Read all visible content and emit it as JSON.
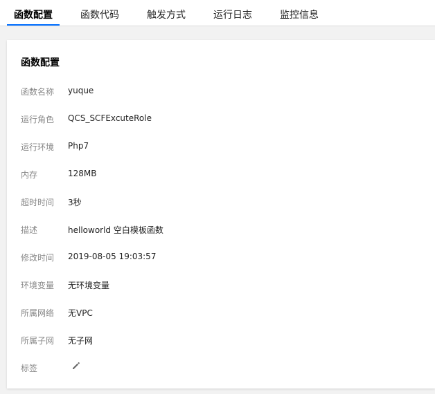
{
  "tabs": [
    {
      "label": "函数配置",
      "active": true
    },
    {
      "label": "函数代码",
      "active": false
    },
    {
      "label": "触发方式",
      "active": false
    },
    {
      "label": "运行日志",
      "active": false
    },
    {
      "label": "监控信息",
      "active": false
    }
  ],
  "accent_color": "#006eff",
  "panel": {
    "title": "函数配置",
    "rows": [
      {
        "label": "函数名称",
        "value": "yuque"
      },
      {
        "label": "运行角色",
        "value": "QCS_SCFExcuteRole"
      },
      {
        "label": "运行环境",
        "value": "Php7"
      },
      {
        "label": "内存",
        "value": "128MB"
      },
      {
        "label": "超时时间",
        "value": "3秒"
      },
      {
        "label": "描述",
        "value": "helloworld 空白模板函数"
      },
      {
        "label": "修改时间",
        "value": "2019-08-05 19:03:57"
      },
      {
        "label": "环境变量",
        "value": "无环境变量"
      },
      {
        "label": "所属网络",
        "value": "无VPC"
      },
      {
        "label": "所属子网",
        "value": "无子网"
      }
    ],
    "tags": {
      "label": "标签",
      "icon": "pencil-icon"
    }
  }
}
